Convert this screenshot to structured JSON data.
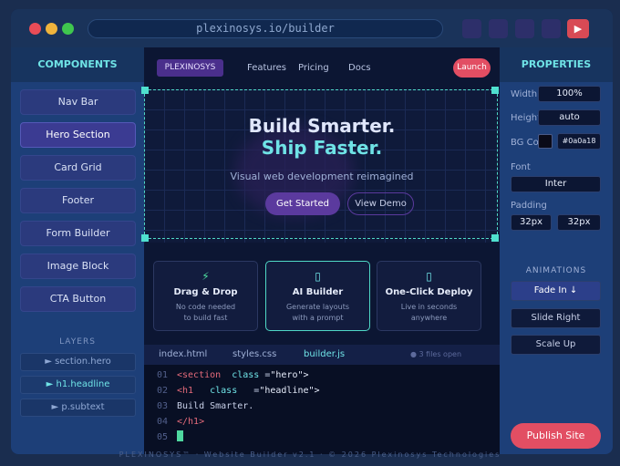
{
  "browser": {
    "url": "plexinosys.io/builder",
    "colors": {
      "close": "#e94c57",
      "minimize": "#f0b43c",
      "maximize": "#3fc74e"
    }
  },
  "left_panel": {
    "title": "COMPONENTS",
    "components": [
      "Nav Bar",
      "Hero Section",
      "Card Grid",
      "Footer",
      "Form Builder",
      "Image Block",
      "CTA Button"
    ],
    "active_component": "Hero Section",
    "layers_title": "LAYERS",
    "layers": [
      "► section.hero",
      "► h1.headline",
      "► p.subtext"
    ]
  },
  "canvas": {
    "brand": "PLEXINOSYS",
    "nav_links": [
      "Features",
      "Pricing",
      "Docs"
    ],
    "launch_label": "Launch",
    "hero": {
      "title_line1": "Build Smarter.",
      "title_line2": "Ship Faster.",
      "subtitle": "Visual web development reimagined",
      "primary_button": "Get Started",
      "secondary_button": "View Demo"
    },
    "cards": [
      {
        "icon": "⚡",
        "title": "Drag & Drop",
        "line1": "No code needed",
        "line2": "to build fast"
      },
      {
        "icon": "▯",
        "title": "AI Builder",
        "line1": "Generate layouts",
        "line2": "with a prompt"
      },
      {
        "icon": "▯",
        "title": "One-Click Deploy",
        "line1": "Live in seconds",
        "line2": "anywhere"
      }
    ]
  },
  "editor": {
    "tabs": [
      "index.html",
      "styles.css",
      "builder.js"
    ],
    "active_tab": "builder.js",
    "files_open": "● 3 files open",
    "lines": [
      {
        "num": "01",
        "tag_open": "<section",
        "attr": "class",
        "eq": "=",
        "val": "\"hero\">"
      },
      {
        "num": "02",
        "tag_open": "<h1",
        "attr": "class",
        "eq": "=",
        "val": "\"headline\">"
      },
      {
        "num": "03",
        "text": "Build Smarter."
      },
      {
        "num": "04",
        "tag_close": "</h1>"
      },
      {
        "num": "05"
      }
    ]
  },
  "right_panel": {
    "title": "PROPERTIES",
    "width_label": "Width",
    "width_value": "100%",
    "height_label": "Height",
    "height_value": "auto",
    "bg_label": "BG Color",
    "bg_value": "#0a0a18",
    "font_label": "Font",
    "font_value": "Inter",
    "padding_label": "Padding",
    "padding_values": [
      "32px",
      "32px"
    ],
    "animations_title": "ANIMATIONS",
    "animations": [
      "Fade In ↓",
      "Slide Right",
      "Scale Up"
    ],
    "active_animation": "Fade In ↓",
    "publish_label": "Publish Site"
  },
  "footer": "PLEXINOSYS™ · Website Builder v2.1 · © 2026 Plexinosys Technologies"
}
